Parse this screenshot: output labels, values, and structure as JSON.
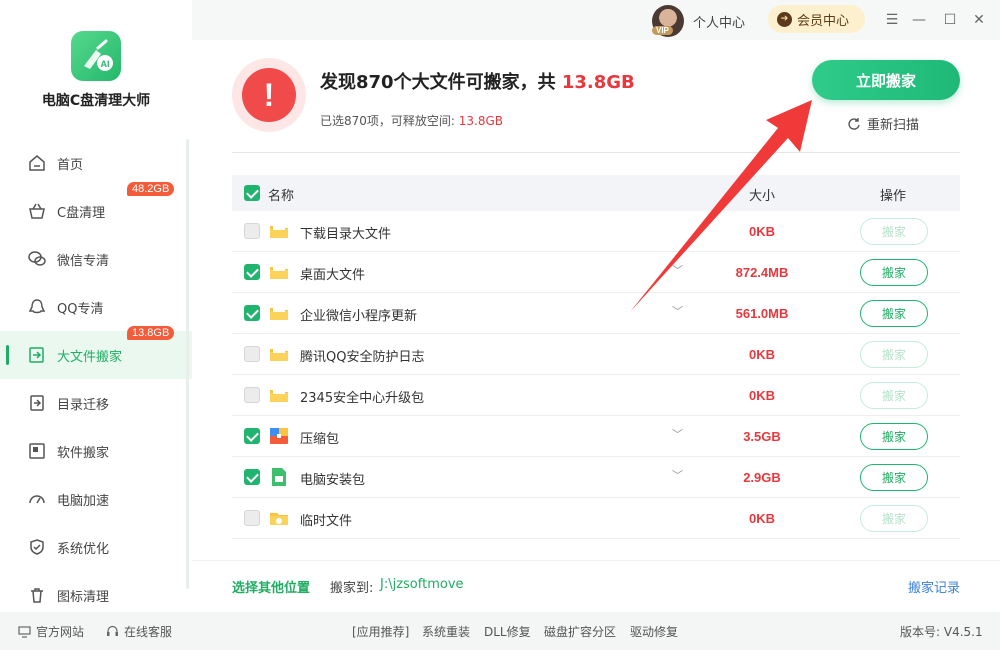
{
  "app": {
    "title": "电脑C盘清理大师",
    "logo_text": "AI"
  },
  "sidebar": {
    "items": [
      {
        "label": "首页",
        "icon": "home-icon",
        "badge": ""
      },
      {
        "label": "C盘清理",
        "icon": "basket-icon",
        "badge": "48.2GB"
      },
      {
        "label": "微信专清",
        "icon": "wechat-icon",
        "badge": ""
      },
      {
        "label": "QQ专清",
        "icon": "qq-icon",
        "badge": ""
      },
      {
        "label": "大文件搬家",
        "icon": "file-move-icon",
        "badge": "13.8GB",
        "active": true
      },
      {
        "label": "目录迁移",
        "icon": "folder-migrate-icon",
        "badge": ""
      },
      {
        "label": "软件搬家",
        "icon": "software-move-icon",
        "badge": ""
      },
      {
        "label": "电脑加速",
        "icon": "speedometer-icon",
        "badge": ""
      },
      {
        "label": "系统优化",
        "icon": "shield-icon",
        "badge": ""
      },
      {
        "label": "图标清理",
        "icon": "trash-icon",
        "badge": ""
      }
    ]
  },
  "topbar": {
    "vip_tag": "VIP",
    "personal": "个人中心",
    "member": "会员中心"
  },
  "summary": {
    "headline_prefix": "发现870个大文件可搬家，共",
    "headline_size": "13.8GB",
    "sub_prefix": "已选870项，可释放空间:",
    "sub_size": "13.8GB",
    "move_now": "立即搬家",
    "rescan": "重新扫描"
  },
  "table": {
    "headers": {
      "name": "名称",
      "size": "大小",
      "op": "操作"
    },
    "action_label": "搬家",
    "rows": [
      {
        "name": "下载目录大文件",
        "size": "0KB",
        "checked": false,
        "expandable": false,
        "icon": "folder-icon"
      },
      {
        "name": "桌面大文件",
        "size": "872.4MB",
        "checked": true,
        "expandable": true,
        "icon": "folder-icon"
      },
      {
        "name": "企业微信小程序更新",
        "size": "561.0MB",
        "checked": true,
        "expandable": true,
        "icon": "folder-icon"
      },
      {
        "name": "腾讯QQ安全防护日志",
        "size": "0KB",
        "checked": false,
        "expandable": false,
        "icon": "folder-icon"
      },
      {
        "name": "2345安全中心升级包",
        "size": "0KB",
        "checked": false,
        "expandable": false,
        "icon": "folder-icon"
      },
      {
        "name": "压缩包",
        "size": "3.5GB",
        "checked": true,
        "expandable": true,
        "icon": "archive-icon"
      },
      {
        "name": "电脑安装包",
        "size": "2.9GB",
        "checked": true,
        "expandable": true,
        "icon": "installer-icon"
      },
      {
        "name": "临时文件",
        "size": "0KB",
        "checked": false,
        "expandable": false,
        "icon": "temp-folder-icon"
      }
    ]
  },
  "bottom": {
    "other_location": "选择其他位置",
    "dest_label": "搬家到:",
    "dest_path": "J:\\jzsoftmove",
    "record": "搬家记录"
  },
  "status": {
    "website": "官方网站",
    "support": "在线客服",
    "links": [
      "[应用推荐]",
      "系统重装",
      "DLL修复",
      "磁盘扩容分区",
      "驱动修复"
    ],
    "version": "版本号: V4.5.1"
  },
  "colors": {
    "accent": "#1fae63",
    "danger": "#e8383d",
    "badge": "#f25c3b",
    "link": "#3b7fd9"
  }
}
